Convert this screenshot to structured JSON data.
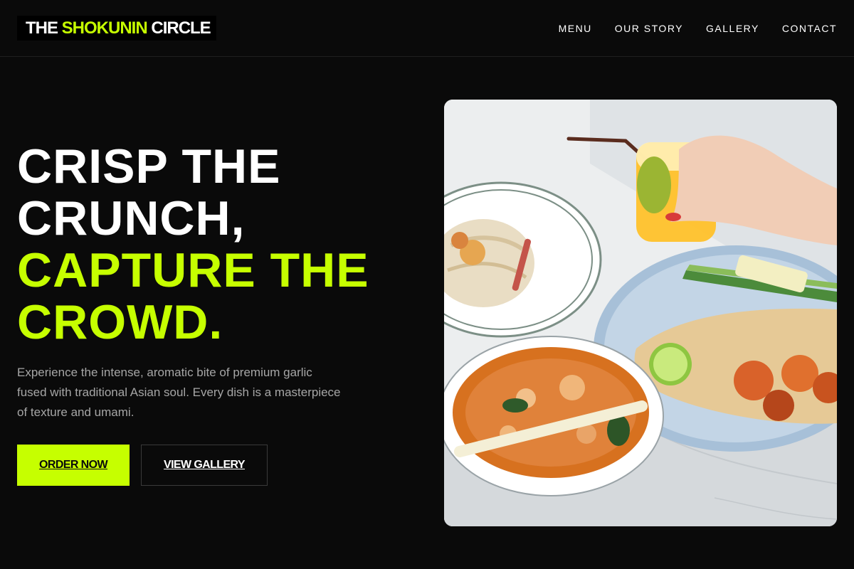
{
  "header": {
    "logo": {
      "part1": "THE ",
      "part2": "SHOKUNIN",
      "part3": " CIRCLE"
    },
    "nav": [
      "MENU",
      "OUR STORY",
      "GALLERY",
      "CONTACT"
    ]
  },
  "hero": {
    "headline": {
      "line1": "CRISP THE",
      "line2": "CRUNCH,",
      "line3": "CAPTURE THE",
      "line4": "CROWD."
    },
    "description": "Experience the intense, aromatic bite of premium garlic fused with traditional Asian soul. Every dish is a masterpiece of texture and umami.",
    "primary_button": "ORDER NOW",
    "secondary_button": "VIEW GALLERY"
  },
  "colors": {
    "background": "#0a0a0a",
    "accent": "#c6ff00",
    "text": "#ffffff",
    "muted_text": "#a6a6a6"
  }
}
